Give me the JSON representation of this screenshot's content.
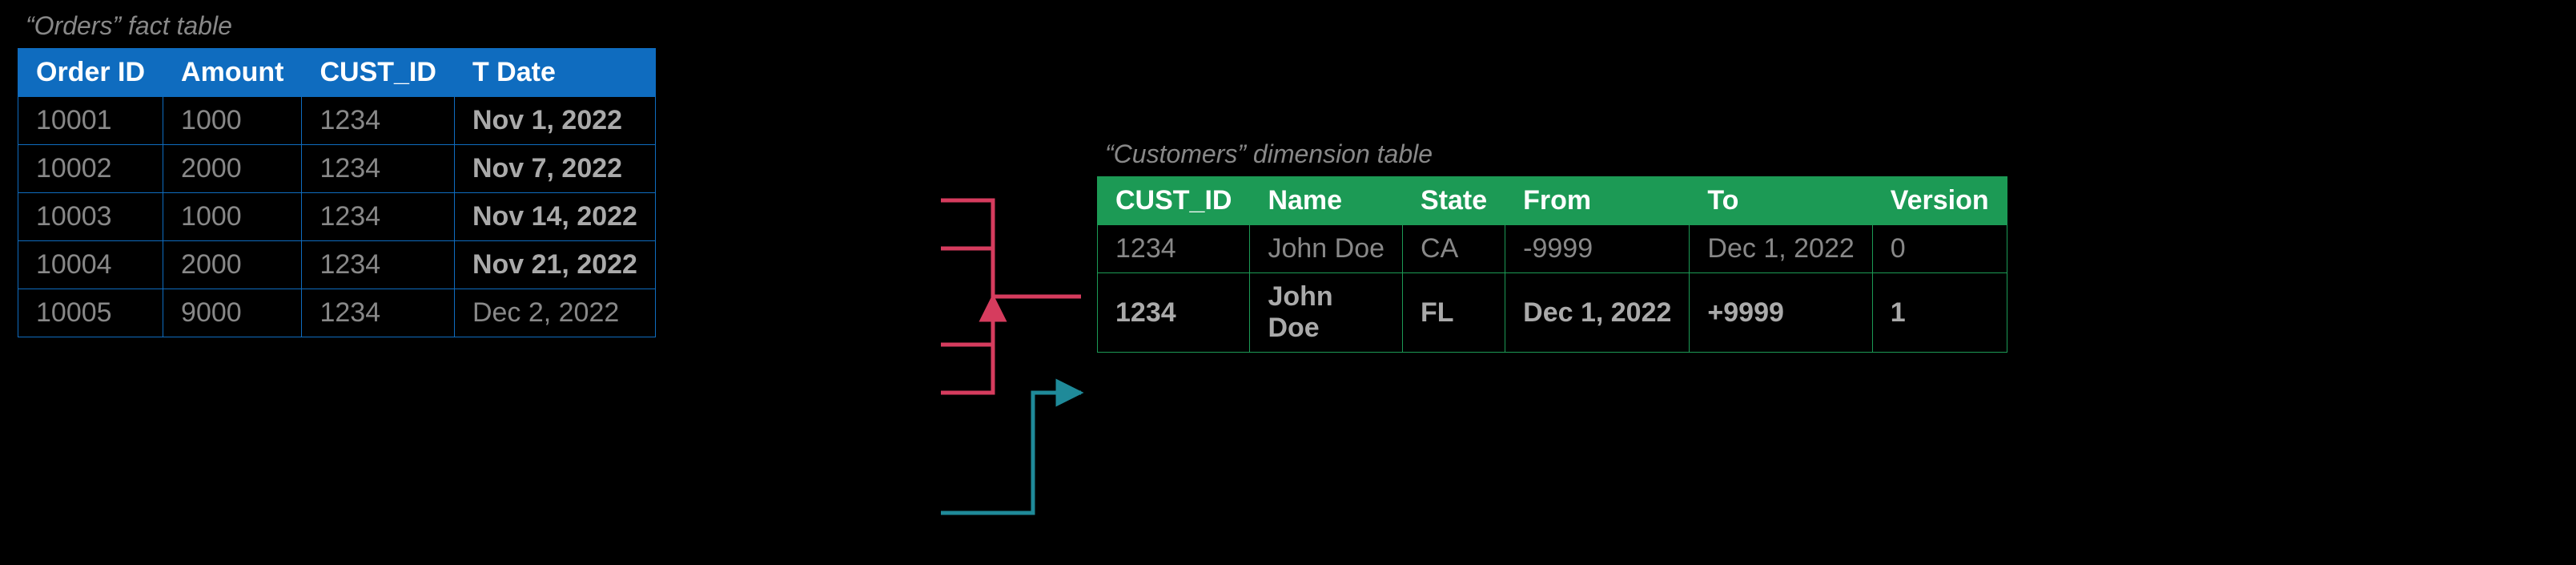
{
  "orders": {
    "caption": "“Orders” fact table",
    "headers": [
      "Order ID",
      "Amount",
      "CUST_ID",
      "T Date"
    ],
    "rows": [
      {
        "id": "10001",
        "amount": "1000",
        "cust": "1234",
        "tdate": "Nov 1, 2022",
        "bold_date": true
      },
      {
        "id": "10002",
        "amount": "2000",
        "cust": "1234",
        "tdate": "Nov 7, 2022",
        "bold_date": true
      },
      {
        "id": "10003",
        "amount": "1000",
        "cust": "1234",
        "tdate": "Nov 14, 2022",
        "bold_date": true
      },
      {
        "id": "10004",
        "amount": "2000",
        "cust": "1234",
        "tdate": "Nov 21, 2022",
        "bold_date": true
      },
      {
        "id": "10005",
        "amount": "9000",
        "cust": "1234",
        "tdate": "Dec 2, 2022",
        "bold_date": false
      }
    ]
  },
  "customers": {
    "caption": "“Customers” dimension table",
    "headers": [
      "CUST_ID",
      "Name",
      "State",
      "From",
      "To",
      "Version"
    ],
    "rows": [
      {
        "cust": "1234",
        "name": "John Doe",
        "state": "CA",
        "from": "-9999",
        "to": "Dec 1, 2022",
        "version": "0",
        "bold": false
      },
      {
        "cust": "1234",
        "name": "John Doe",
        "state": "FL",
        "from": "Dec 1, 2022",
        "to": "+9999",
        "version": "1",
        "bold": true
      }
    ]
  },
  "arrows": {
    "red_color": "#d63c5e",
    "teal_color": "#1f8a99"
  }
}
